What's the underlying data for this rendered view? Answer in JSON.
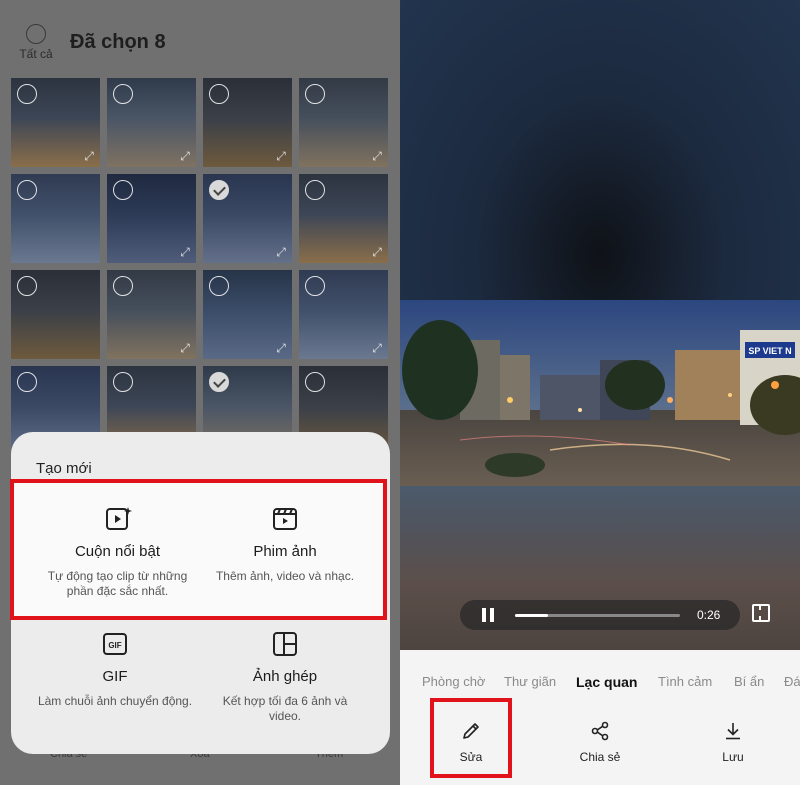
{
  "left": {
    "select_all_label": "Tất cả",
    "selection_title": "Đã chọn 8",
    "thumbnails": [
      {
        "checked": false,
        "expand": true
      },
      {
        "checked": false,
        "expand": true
      },
      {
        "checked": false,
        "expand": true
      },
      {
        "checked": false,
        "expand": true
      },
      {
        "checked": false,
        "expand": false
      },
      {
        "checked": false,
        "expand": true
      },
      {
        "checked": true,
        "expand": true
      },
      {
        "checked": false,
        "expand": true
      },
      {
        "checked": false,
        "expand": false
      },
      {
        "checked": false,
        "expand": true
      },
      {
        "checked": false,
        "expand": true
      },
      {
        "checked": false,
        "expand": true
      },
      {
        "checked": false,
        "expand": false
      },
      {
        "checked": false,
        "expand": false
      },
      {
        "checked": true,
        "expand": false
      },
      {
        "checked": false,
        "expand": false
      }
    ],
    "sheet": {
      "title": "Tạo mới",
      "options": [
        {
          "name": "Cuộn nổi bật",
          "desc": "Tự động tạo clip từ những phần đặc sắc nhất.",
          "icon": "highlight-reel-icon"
        },
        {
          "name": "Phim ảnh",
          "desc": "Thêm ảnh, video và nhạc.",
          "icon": "movie-clapper-icon"
        },
        {
          "name": "GIF",
          "desc": "Làm chuỗi ảnh chuyển động.",
          "icon": "gif-icon"
        },
        {
          "name": "Ảnh ghép",
          "desc": "Kết hợp tối đa 6 ảnh và video.",
          "icon": "collage-icon"
        }
      ]
    },
    "behind_sheet_labels": [
      "Chia sẻ",
      "Xóa",
      "Thêm"
    ]
  },
  "right": {
    "player": {
      "time": "0:26",
      "progress": 0.2
    },
    "themes": [
      "Phòng chờ",
      "Thư giãn",
      "Lạc quan",
      "Tình cảm",
      "Bí ẩn",
      "Đá"
    ],
    "active_theme": "Lạc quan",
    "actions": [
      {
        "label": "Sửa",
        "icon": "pencil-icon"
      },
      {
        "label": "Chia sẻ",
        "icon": "share-icon"
      },
      {
        "label": "Lưu",
        "icon": "download-icon"
      }
    ],
    "sign_text": "SP VIET N"
  },
  "colors": {
    "highlight": "#e0131a",
    "sheet_bg": "#ececec",
    "overlay": "#707070"
  }
}
